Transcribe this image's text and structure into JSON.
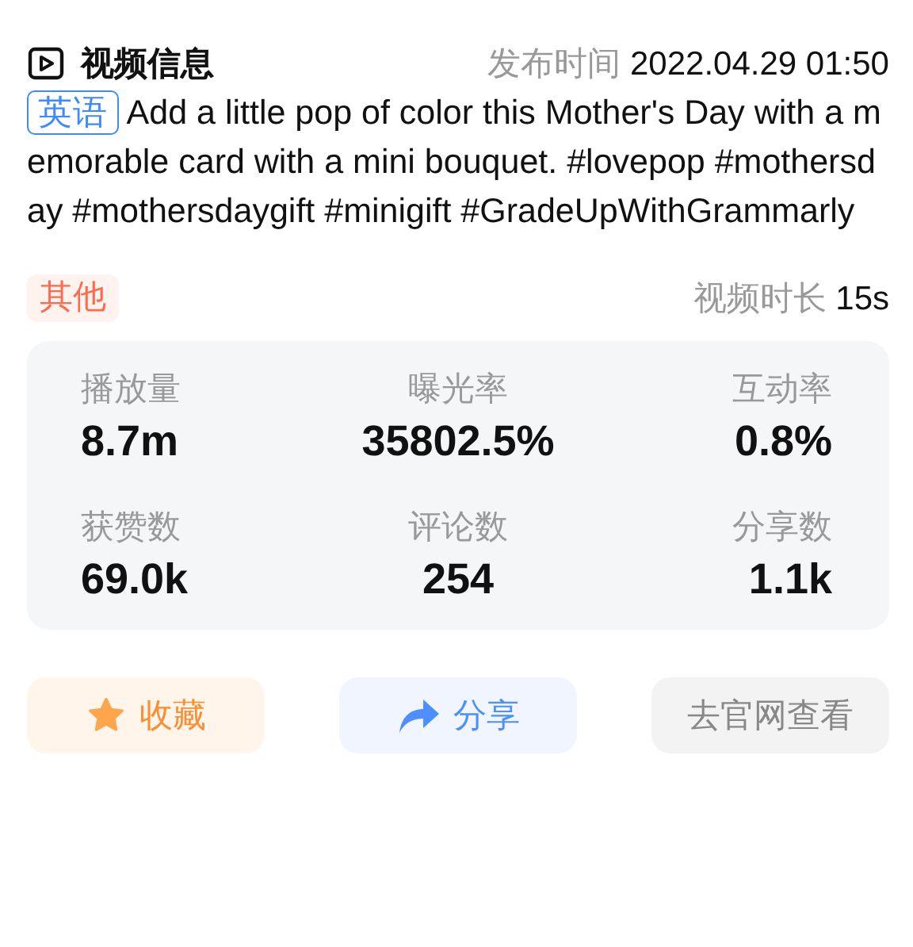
{
  "header": {
    "title": "视频信息",
    "publish_label": "发布时间",
    "publish_time": "2022.04.29 01:50"
  },
  "language_tag": "英语",
  "description": "Add a little pop of color this Mother's Day with a memorable card with a mini bouquet. #lovepop #mothersday #mothersdaygift #minigift #GradeUpWithGrammarly",
  "category_tag": "其他",
  "duration": {
    "label": "视频时长",
    "value": "15s"
  },
  "stats": [
    {
      "label": "播放量",
      "value": "8.7m"
    },
    {
      "label": "曝光率",
      "value": "35802.5%"
    },
    {
      "label": "互动率",
      "value": "0.8%"
    },
    {
      "label": "获赞数",
      "value": "69.0k"
    },
    {
      "label": "评论数",
      "value": "254"
    },
    {
      "label": "分享数",
      "value": "1.1k"
    }
  ],
  "buttons": [
    {
      "kind": "favorite",
      "label": "收藏"
    },
    {
      "kind": "share",
      "label": "分享"
    },
    {
      "kind": "website",
      "label": "去官网查看"
    }
  ]
}
